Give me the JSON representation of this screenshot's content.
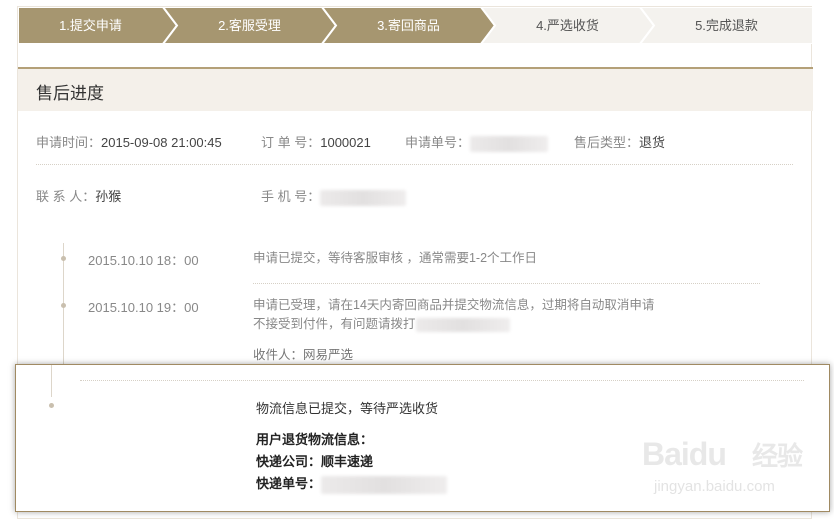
{
  "steps": [
    {
      "label": "1.提交申请",
      "done": true
    },
    {
      "label": "2.客服受理",
      "done": true
    },
    {
      "label": "3.寄回商品",
      "done": true
    },
    {
      "label": "4.严选收货",
      "done": false
    },
    {
      "label": "5.完成退款",
      "done": false
    }
  ],
  "colors": {
    "step_done": "#a69670",
    "step_todo": "#f4f2ee",
    "accent": "#b4a078"
  },
  "section_title": "售后进度",
  "info": {
    "apply_time_label": "申请时间：",
    "apply_time_value": "2015-09-08  21:00:45",
    "order_label": "订 单 号：",
    "order_value": "1000021",
    "apply_no_label": "申请单号：",
    "type_label": "售后类型：",
    "type_value": "退货",
    "contact_label": "联 系 人：",
    "contact_value": "孙猴",
    "phone_label": "手 机 号："
  },
  "timeline": [
    {
      "time": "2015.10.10  18：00",
      "lines": [
        "申请已提交，等待客服审核 ，通常需要1-2个工作日"
      ]
    },
    {
      "time": "2015.10.10  19：00",
      "lines": [
        "申请已受理，请在14天内寄回商品并提交物流信息，过期将自动取消申请",
        "不接受到付件，有问题请拨打"
      ],
      "receiver": "收件人：网易严选"
    }
  ],
  "highlight": {
    "status": "物流信息已提交，等待严选收货",
    "logistics_title": "用户退货物流信息：",
    "company_label": "快递公司：",
    "company_value": "顺丰速递",
    "tracking_label": "快递单号："
  },
  "watermark": {
    "logo": "Baidu",
    "brand": "经验",
    "url": "jingyan.baidu.com"
  }
}
